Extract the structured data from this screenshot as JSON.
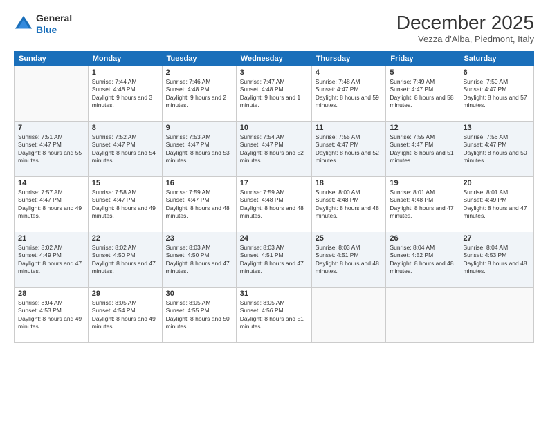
{
  "logo": {
    "line1": "General",
    "line2": "Blue"
  },
  "title": "December 2025",
  "subtitle": "Vezza d'Alba, Piedmont, Italy",
  "days_of_week": [
    "Sunday",
    "Monday",
    "Tuesday",
    "Wednesday",
    "Thursday",
    "Friday",
    "Saturday"
  ],
  "weeks": [
    [
      {
        "day": "",
        "sunrise": "",
        "sunset": "",
        "daylight": ""
      },
      {
        "day": "1",
        "sunrise": "7:44 AM",
        "sunset": "4:48 PM",
        "daylight": "9 hours and 3 minutes."
      },
      {
        "day": "2",
        "sunrise": "7:46 AM",
        "sunset": "4:48 PM",
        "daylight": "9 hours and 2 minutes."
      },
      {
        "day": "3",
        "sunrise": "7:47 AM",
        "sunset": "4:48 PM",
        "daylight": "9 hours and 1 minute."
      },
      {
        "day": "4",
        "sunrise": "7:48 AM",
        "sunset": "4:47 PM",
        "daylight": "8 hours and 59 minutes."
      },
      {
        "day": "5",
        "sunrise": "7:49 AM",
        "sunset": "4:47 PM",
        "daylight": "8 hours and 58 minutes."
      },
      {
        "day": "6",
        "sunrise": "7:50 AM",
        "sunset": "4:47 PM",
        "daylight": "8 hours and 57 minutes."
      }
    ],
    [
      {
        "day": "7",
        "sunrise": "7:51 AM",
        "sunset": "4:47 PM",
        "daylight": "8 hours and 55 minutes."
      },
      {
        "day": "8",
        "sunrise": "7:52 AM",
        "sunset": "4:47 PM",
        "daylight": "8 hours and 54 minutes."
      },
      {
        "day": "9",
        "sunrise": "7:53 AM",
        "sunset": "4:47 PM",
        "daylight": "8 hours and 53 minutes."
      },
      {
        "day": "10",
        "sunrise": "7:54 AM",
        "sunset": "4:47 PM",
        "daylight": "8 hours and 52 minutes."
      },
      {
        "day": "11",
        "sunrise": "7:55 AM",
        "sunset": "4:47 PM",
        "daylight": "8 hours and 52 minutes."
      },
      {
        "day": "12",
        "sunrise": "7:55 AM",
        "sunset": "4:47 PM",
        "daylight": "8 hours and 51 minutes."
      },
      {
        "day": "13",
        "sunrise": "7:56 AM",
        "sunset": "4:47 PM",
        "daylight": "8 hours and 50 minutes."
      }
    ],
    [
      {
        "day": "14",
        "sunrise": "7:57 AM",
        "sunset": "4:47 PM",
        "daylight": "8 hours and 49 minutes."
      },
      {
        "day": "15",
        "sunrise": "7:58 AM",
        "sunset": "4:47 PM",
        "daylight": "8 hours and 49 minutes."
      },
      {
        "day": "16",
        "sunrise": "7:59 AM",
        "sunset": "4:47 PM",
        "daylight": "8 hours and 48 minutes."
      },
      {
        "day": "17",
        "sunrise": "7:59 AM",
        "sunset": "4:48 PM",
        "daylight": "8 hours and 48 minutes."
      },
      {
        "day": "18",
        "sunrise": "8:00 AM",
        "sunset": "4:48 PM",
        "daylight": "8 hours and 48 minutes."
      },
      {
        "day": "19",
        "sunrise": "8:01 AM",
        "sunset": "4:48 PM",
        "daylight": "8 hours and 47 minutes."
      },
      {
        "day": "20",
        "sunrise": "8:01 AM",
        "sunset": "4:49 PM",
        "daylight": "8 hours and 47 minutes."
      }
    ],
    [
      {
        "day": "21",
        "sunrise": "8:02 AM",
        "sunset": "4:49 PM",
        "daylight": "8 hours and 47 minutes."
      },
      {
        "day": "22",
        "sunrise": "8:02 AM",
        "sunset": "4:50 PM",
        "daylight": "8 hours and 47 minutes."
      },
      {
        "day": "23",
        "sunrise": "8:03 AM",
        "sunset": "4:50 PM",
        "daylight": "8 hours and 47 minutes."
      },
      {
        "day": "24",
        "sunrise": "8:03 AM",
        "sunset": "4:51 PM",
        "daylight": "8 hours and 47 minutes."
      },
      {
        "day": "25",
        "sunrise": "8:03 AM",
        "sunset": "4:51 PM",
        "daylight": "8 hours and 48 minutes."
      },
      {
        "day": "26",
        "sunrise": "8:04 AM",
        "sunset": "4:52 PM",
        "daylight": "8 hours and 48 minutes."
      },
      {
        "day": "27",
        "sunrise": "8:04 AM",
        "sunset": "4:53 PM",
        "daylight": "8 hours and 48 minutes."
      }
    ],
    [
      {
        "day": "28",
        "sunrise": "8:04 AM",
        "sunset": "4:53 PM",
        "daylight": "8 hours and 49 minutes."
      },
      {
        "day": "29",
        "sunrise": "8:05 AM",
        "sunset": "4:54 PM",
        "daylight": "8 hours and 49 minutes."
      },
      {
        "day": "30",
        "sunrise": "8:05 AM",
        "sunset": "4:55 PM",
        "daylight": "8 hours and 50 minutes."
      },
      {
        "day": "31",
        "sunrise": "8:05 AM",
        "sunset": "4:56 PM",
        "daylight": "8 hours and 51 minutes."
      },
      {
        "day": "",
        "sunrise": "",
        "sunset": "",
        "daylight": ""
      },
      {
        "day": "",
        "sunrise": "",
        "sunset": "",
        "daylight": ""
      },
      {
        "day": "",
        "sunrise": "",
        "sunset": "",
        "daylight": ""
      }
    ]
  ]
}
